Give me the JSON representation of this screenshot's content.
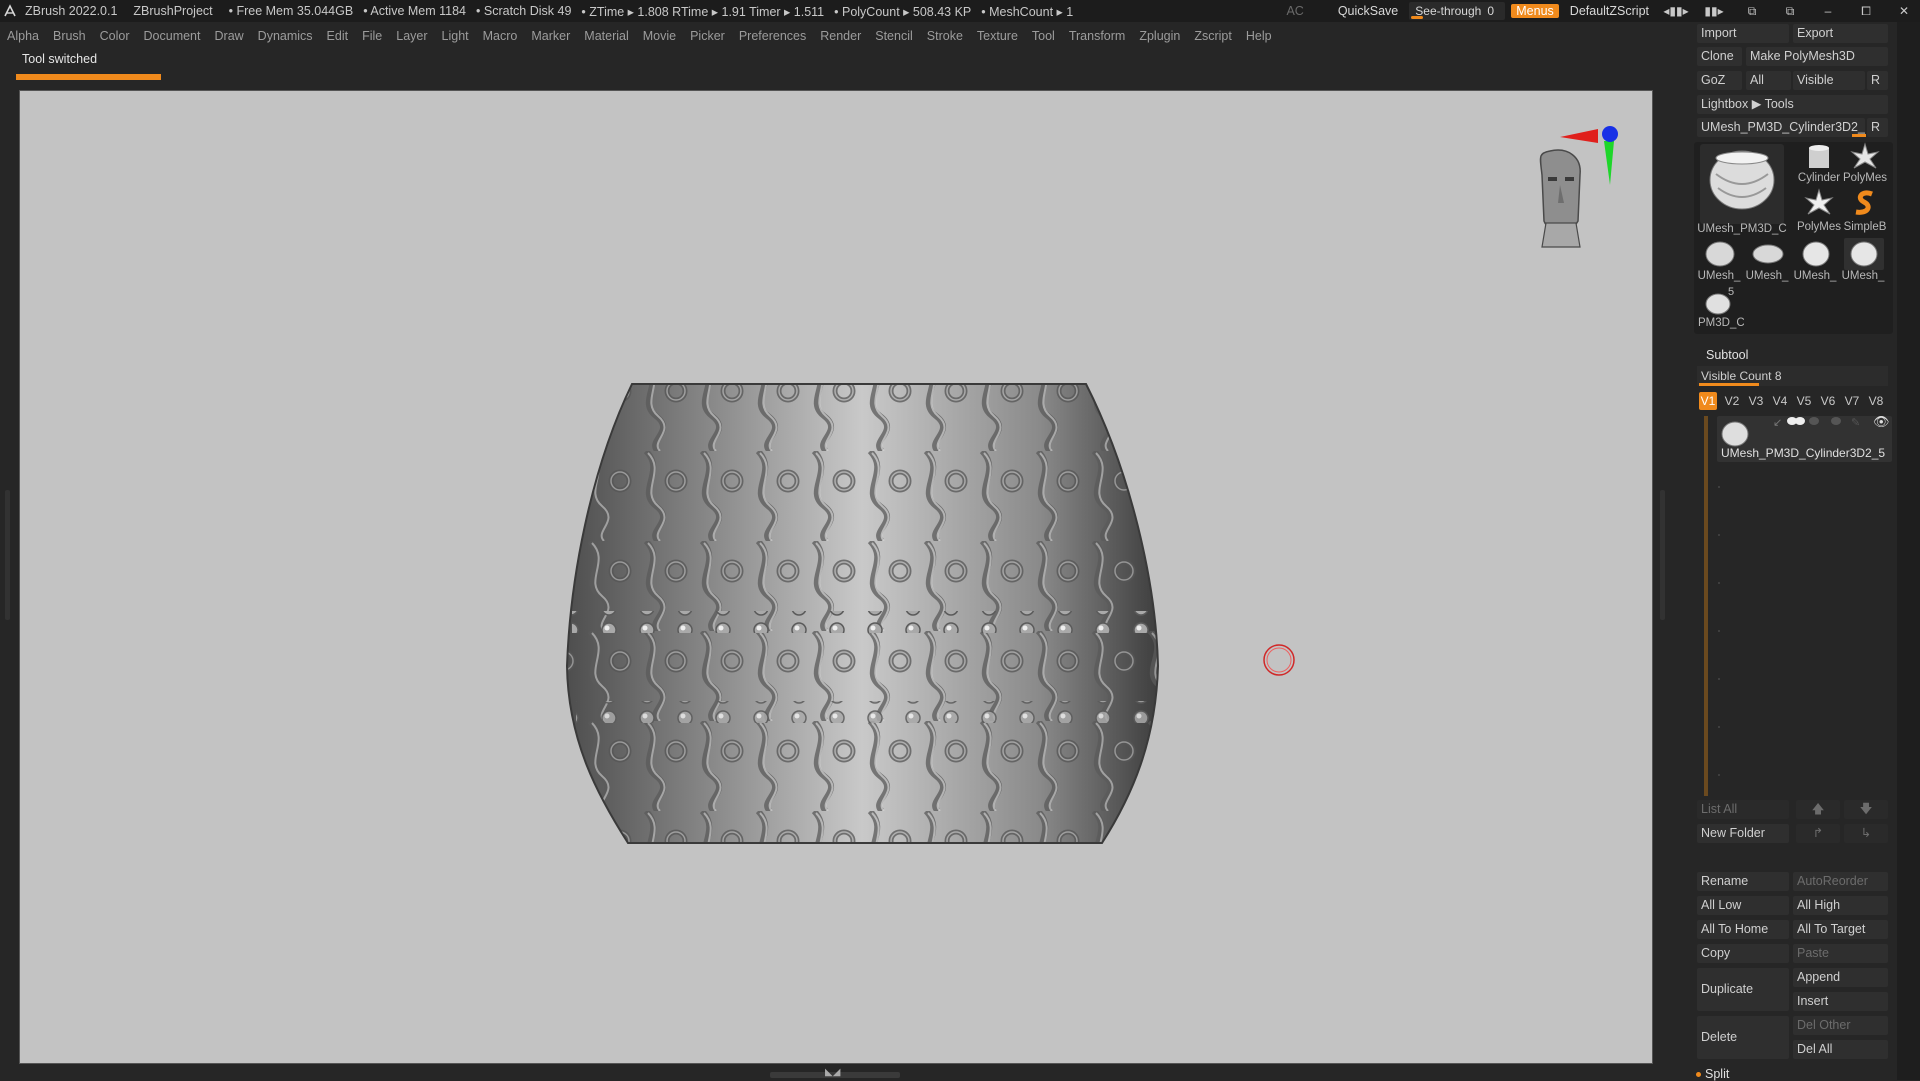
{
  "titlebar": {
    "app": "ZBrush 2022.0.1",
    "project": "ZBrushProject",
    "free_mem": "• Free Mem 35.044GB",
    "active_mem": "• Active Mem 1184",
    "scratch": "• Scratch Disk 49",
    "ztime": "• ZTime ▸ 1.808 RTime ▸ 1.91 Timer ▸ 1.511",
    "polycount": "• PolyCount ▸ 508.43 KP",
    "meshcount": "• MeshCount ▸ 1",
    "ac": "AC",
    "quicksave": "QuickSave",
    "see_through_label": "See-through",
    "see_through_value": "0",
    "menus": "Menus",
    "default_zscript": "DefaultZScript"
  },
  "menubar": [
    "Alpha",
    "Brush",
    "Color",
    "Document",
    "Draw",
    "Dynamics",
    "Edit",
    "File",
    "Layer",
    "Light",
    "Macro",
    "Marker",
    "Material",
    "Movie",
    "Picker",
    "Preferences",
    "Render",
    "Stencil",
    "Stroke",
    "Texture",
    "Tool",
    "Transform",
    "Zplugin",
    "Zscript",
    "Help"
  ],
  "notice": "Tool switched",
  "toolpanel": {
    "import": "Import",
    "export": "Export",
    "clone": "Clone",
    "make_polymesh": "Make PolyMesh3D",
    "goz": "GoZ",
    "all": "All",
    "visible": "Visible",
    "r": "R",
    "lightbox": "Lightbox ▶ Tools",
    "current_tool": "UMesh_PM3D_Cylinder3D2_5",
    "r2": "R",
    "thumbs": [
      "UMesh_PM3D_C",
      "Cylinder",
      "PolyMes",
      "PolyMes",
      "SimpleB",
      "UMesh_",
      "UMesh_",
      "UMesh_",
      "UMesh_",
      "PM3D_C"
    ],
    "thumb_badge": "5"
  },
  "subtool": {
    "title": "Subtool",
    "visible_count": "Visible Count 8",
    "tabs": [
      "V1",
      "V2",
      "V3",
      "V4",
      "V5",
      "V6",
      "V7",
      "V8"
    ],
    "item_name": "UMesh_PM3D_Cylinder3D2_5",
    "list_all": "List All",
    "new_folder": "New Folder",
    "rename": "Rename",
    "autoreorder": "AutoReorder",
    "all_low": "All Low",
    "all_high": "All High",
    "all_to_home": "All To Home",
    "all_to_target": "All To Target",
    "copy": "Copy",
    "paste": "Paste",
    "duplicate": "Duplicate",
    "append": "Append",
    "insert": "Insert",
    "delete": "Delete",
    "del_other": "Del Other",
    "del_all": "Del All",
    "split": "Split"
  },
  "colors": {
    "accent": "#f08a1c",
    "canvas": "#c3c3c3",
    "panel": "#262626",
    "button": "#2f2f2f"
  },
  "icons": [
    "zbrush-logo-icon",
    "layout-icon",
    "window-icon",
    "minimize-icon",
    "maximize-icon",
    "close-icon",
    "navigation-head-icon",
    "axis-gizmo-icon",
    "brush-cursor-icon"
  ]
}
